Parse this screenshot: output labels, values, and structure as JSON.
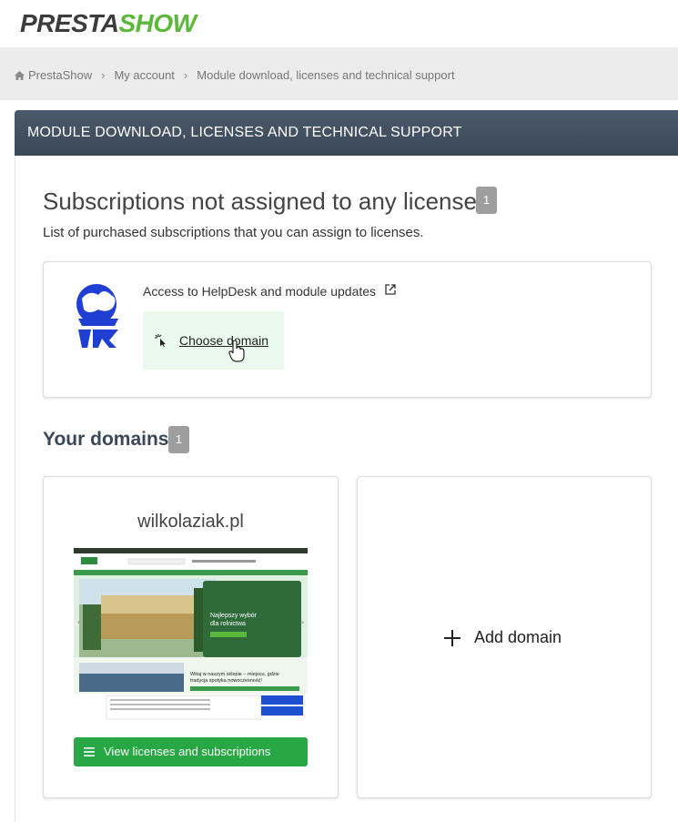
{
  "brand": {
    "part1": "PRESTA",
    "part2": "SHOW"
  },
  "breadcrumb": {
    "items": [
      "PrestaShow",
      "My account",
      "Module download, licenses and technical support"
    ],
    "separator": "›"
  },
  "header": {
    "title": "MODULE DOWNLOAD, LICENSES AND TECHNICAL SUPPORT"
  },
  "subscriptions": {
    "title": "Subscriptions not assigned to any license",
    "count": "1",
    "description": "List of purchased subscriptions that you can assign to licenses.",
    "item": {
      "title": "Access to HelpDesk and module updates",
      "choose_label": "Choose domain",
      "icon": "helpdesk-logo-icon"
    }
  },
  "domains": {
    "title": "Your domains",
    "count": "1",
    "items": [
      {
        "name": "wilkolaziak.pl",
        "button_label": "View licenses and subscriptions",
        "preview": {
          "hero_title": "Najlepszy wybór dla rolnictwa",
          "welcome": "Witaj w naszym sklepie – miejscu, gdzie tradycja spotyka nowoczesność!"
        }
      }
    ],
    "add_label": "Add domain"
  },
  "colors": {
    "brand_green": "#5bb83b",
    "header_bg": "#3b4858",
    "button_green": "#28a745",
    "choose_bg": "#eafaee",
    "badge_gray": "#9e9e9e"
  }
}
